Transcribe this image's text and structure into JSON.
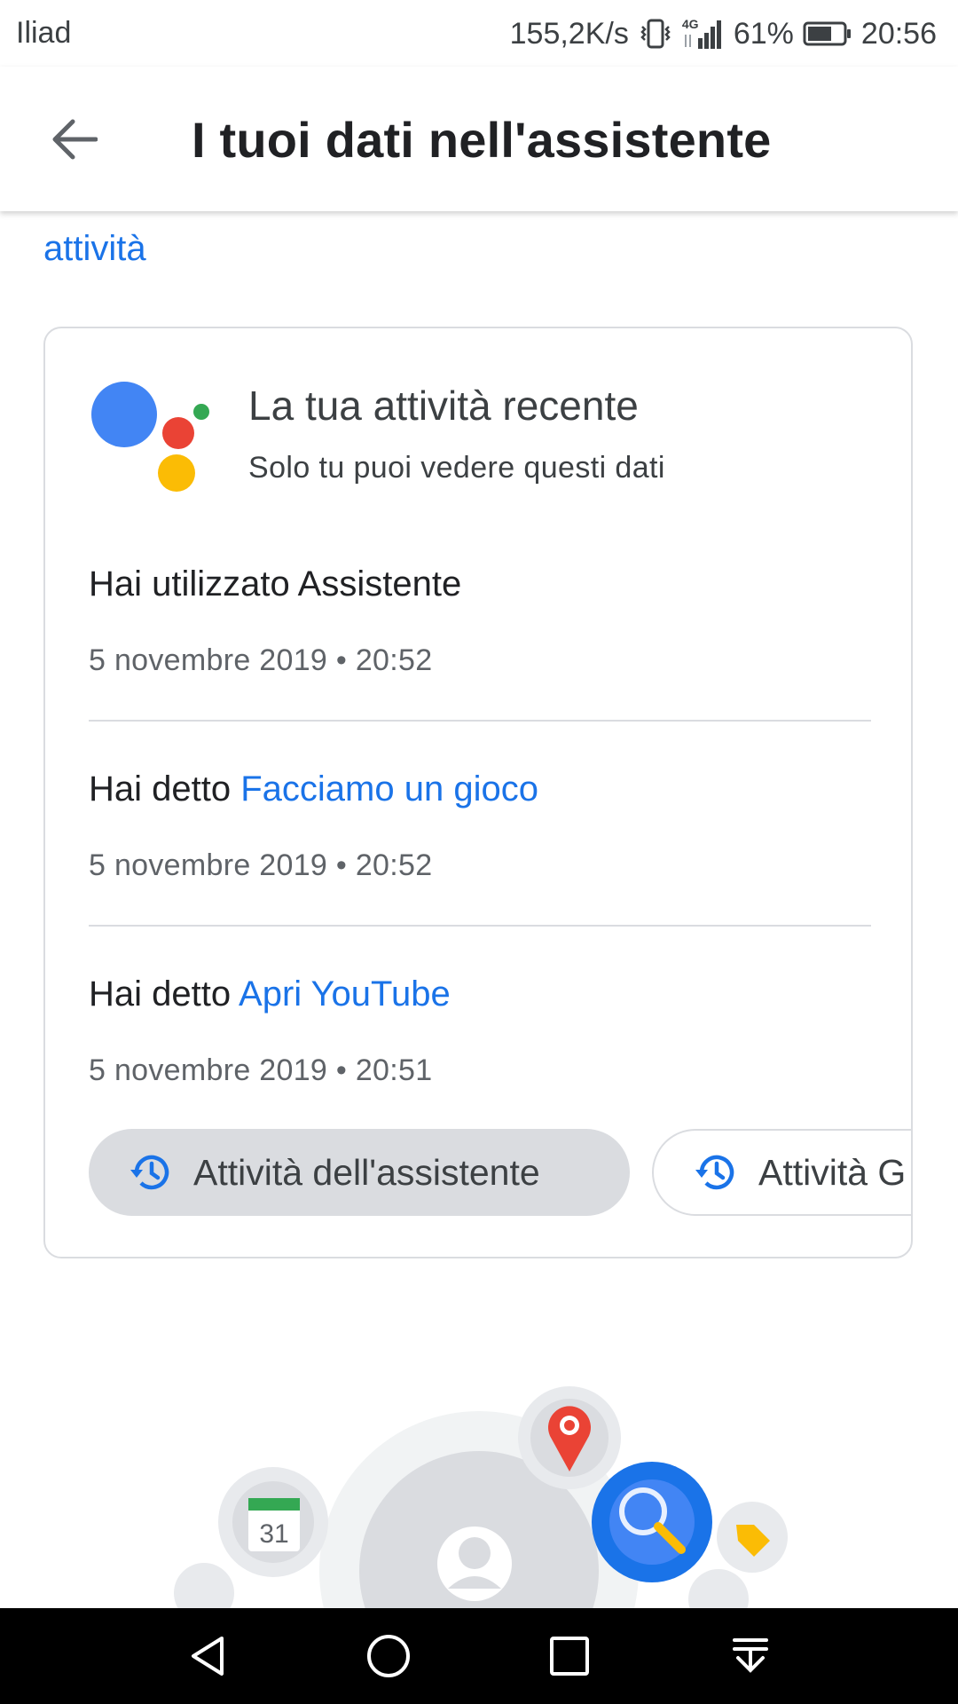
{
  "status_bar": {
    "carrier": "Iliad",
    "speed": "155,2K/s",
    "network": "4G",
    "battery": "61%",
    "time": "20:56"
  },
  "app_bar": {
    "back_icon": "arrow-back-icon",
    "title": "I tuoi dati nell'assistente"
  },
  "link_text": "attività",
  "recent_card": {
    "title": "La tua attività recente",
    "subtitle": "Solo tu puoi vedere questi dati",
    "logo_colors": [
      "#4285f4",
      "#ea4335",
      "#fbbc05",
      "#34a853"
    ],
    "activities": [
      {
        "prefix": "Hai utilizzato Assistente",
        "query": "",
        "time": "5 novembre 2019 • 20:52"
      },
      {
        "prefix": "Hai detto ",
        "query": "Facciamo un gioco",
        "time": "5 novembre 2019 • 20:52"
      },
      {
        "prefix": "Hai detto ",
        "query": "Apri YouTube",
        "time": "5 novembre 2019 • 20:51"
      }
    ],
    "chips": [
      {
        "label": "Attività dell'assistente",
        "icon": "history-icon"
      },
      {
        "label": "Attività G",
        "icon": "history-icon"
      }
    ]
  },
  "illustration": {
    "calendar_day": "31"
  },
  "colors": {
    "accent": "#1a73e8",
    "chip_active_bg": "#dadce0"
  }
}
